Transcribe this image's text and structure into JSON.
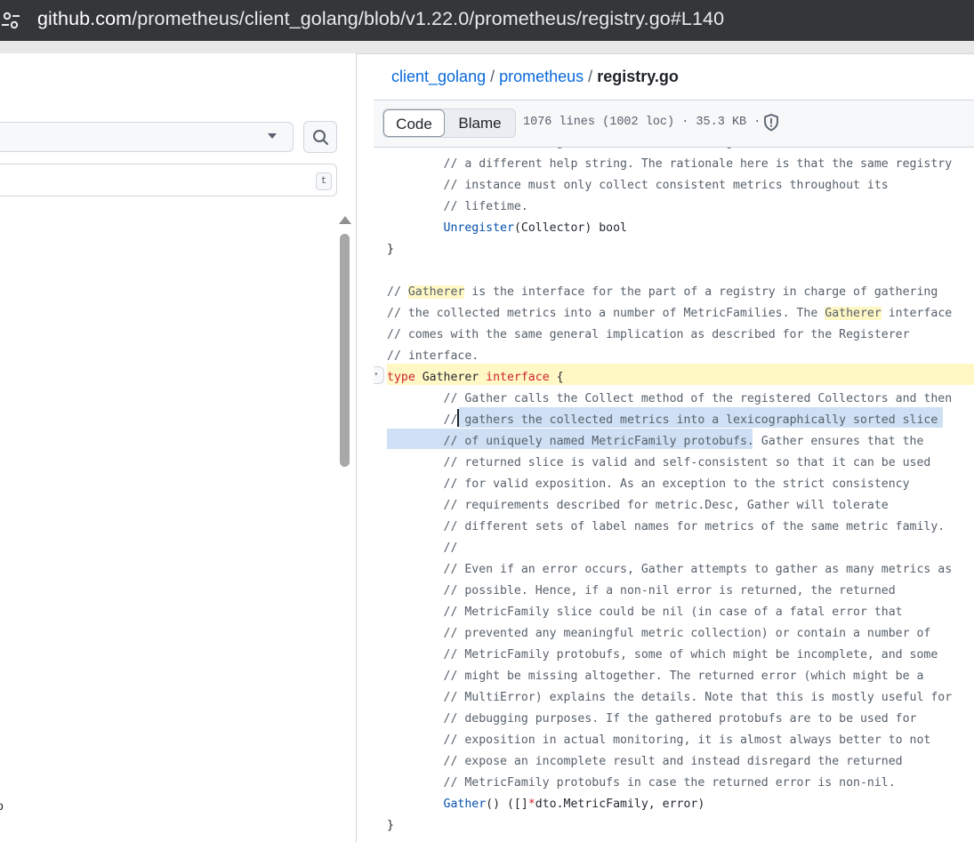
{
  "browser": {
    "url_host": "github.com",
    "url_path": "/prometheus/client_golang/blob/v1.22.0/prometheus/registry.go#L140"
  },
  "sidebar": {
    "filter_shortcut": "t",
    "trailing_glyph": "o"
  },
  "breadcrumb": {
    "repo": "client_golang",
    "dir": "prometheus",
    "file": "registry.go",
    "separator": "/"
  },
  "toolbar": {
    "code_label": "Code",
    "blame_label": "Blame",
    "file_info": "1076 lines (1002 loc) · 35.3 KB ·"
  },
  "code": {
    "lines": [
      "\t// collector, e.g. a Collector collecting metrics with the same name but",
      "\t// a different help string. The rationale here is that the same registry",
      "\t// instance must only collect consistent metrics throughout its",
      "\t// lifetime.",
      "\tUnregister(Collector) bool",
      "}",
      "",
      "// Gatherer is the interface for the part of a registry in charge of gathering",
      "// the collected metrics into a number of MetricFamilies. The Gatherer interface",
      "// comes with the same general implication as described for the Registerer",
      "// interface.",
      "type Gatherer interface {",
      "\t// Gather calls the Collect method of the registered Collectors and then",
      "\t// gathers the collected metrics into a lexicographically sorted slice",
      "\t// of uniquely named MetricFamily protobufs. Gather ensures that the",
      "\t// returned slice is valid and self-consistent so that it can be used",
      "\t// for valid exposition. As an exception to the strict consistency",
      "\t// requirements described for metric.Desc, Gather will tolerate",
      "\t// different sets of label names for metrics of the same metric family.",
      "\t//",
      "\t// Even if an error occurs, Gather attempts to gather as many metrics as",
      "\t// possible. Hence, if a non-nil error is returned, the returned",
      "\t// MetricFamily slice could be nil (in case of a fatal error that",
      "\t// prevented any meaningful metric collection) or contain a number of",
      "\t// MetricFamily protobufs, some of which might be incomplete, and some",
      "\t// might be missing altogether. The returned error (which might be a",
      "\t// MultiError) explains the details. Note that this is mostly useful for",
      "\t// debugging purposes. If the gathered protobufs are to be used for",
      "\t// exposition in actual monitoring, it is almost always better to not",
      "\t// expose an incomplete result and instead disregard the returned",
      "\t// MetricFamily protobufs in case the returned error is non-nil.",
      "\tGather() ([]*dto.MetricFamily, error)",
      "}"
    ]
  },
  "colors": {
    "link": "#0969da",
    "keyword": "#cf222e",
    "function": "#0550ae",
    "comment": "#57606a",
    "highlight": "#fff8c5",
    "selection": "#cfe0f4"
  }
}
